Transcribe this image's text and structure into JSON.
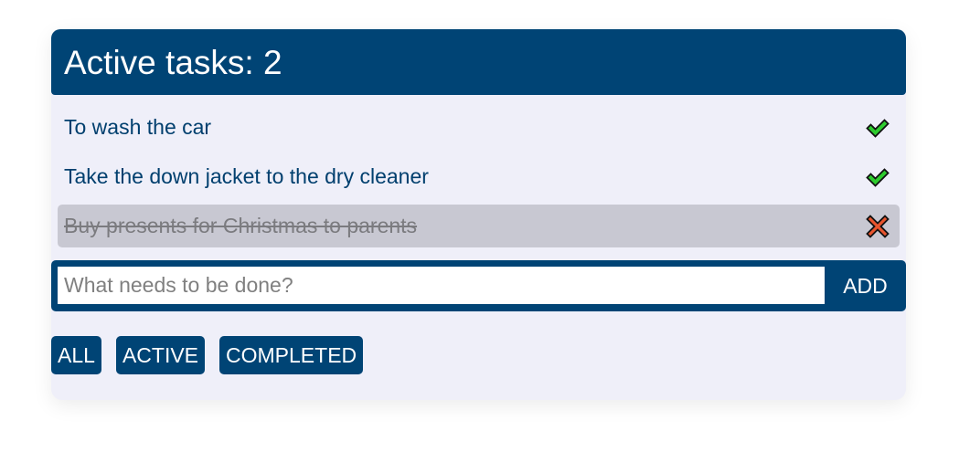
{
  "header": {
    "title": "Active tasks: 2"
  },
  "tasks": [
    {
      "text": "To wash the car",
      "completed": false,
      "icon": "check-icon"
    },
    {
      "text": "Take the down jacket to the dry cleaner",
      "completed": false,
      "icon": "check-icon"
    },
    {
      "text": "Buy presents for Christmas to parents",
      "completed": true,
      "icon": "cross-icon"
    }
  ],
  "add_form": {
    "placeholder": "What needs to be done?",
    "value": "",
    "button_label": "ADD"
  },
  "filters": [
    {
      "label": "ALL"
    },
    {
      "label": "ACTIVE"
    },
    {
      "label": "COMPLETED"
    }
  ],
  "colors": {
    "primary": "#004475",
    "card_background": "#efeff9",
    "completed_background": "#c8c8d2",
    "task_text": "#003f6e",
    "check": "#2ecc2e",
    "cross": "#e8552e"
  }
}
